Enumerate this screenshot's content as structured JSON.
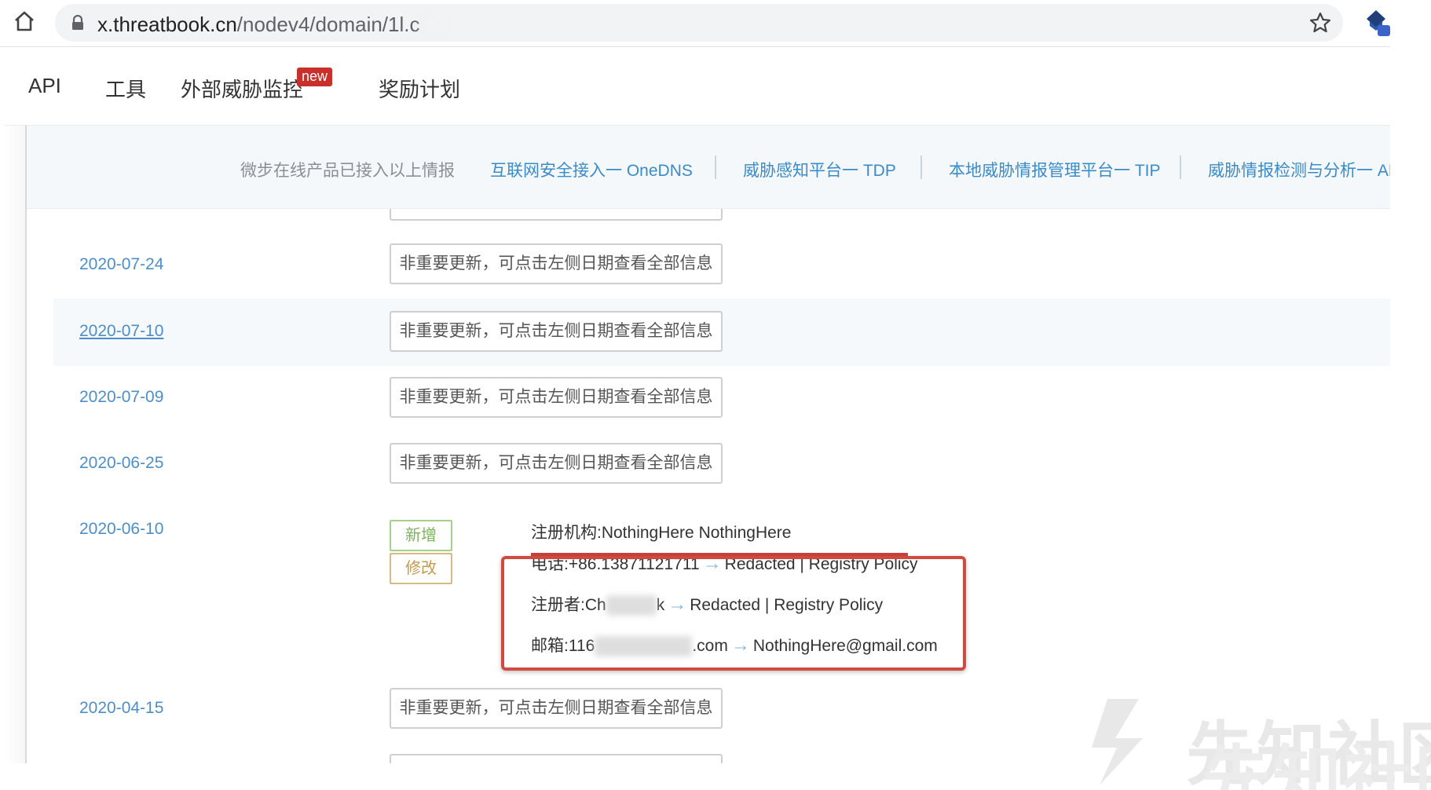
{
  "browser": {
    "url_host": "x.threatbook.cn",
    "url_path": "/nodev4/domain/1l.c",
    "icons": {
      "home": "home-icon",
      "lock": "lock-icon",
      "star": "star-icon",
      "extension": "extension-icon"
    }
  },
  "site_nav": {
    "items": [
      {
        "label": "API"
      },
      {
        "label": "工具"
      },
      {
        "label": "外部威胁监控"
      },
      {
        "label": "奖励计划"
      }
    ],
    "badge": "new"
  },
  "banner": {
    "lead": "微步在线产品已接入以上情报",
    "links": [
      {
        "label": "互联网安全接入一 OneDNS"
      },
      {
        "label": "威胁感知平台一 TDP"
      },
      {
        "label": "本地威胁情报管理平台一 TIP"
      },
      {
        "label": "威胁情报检测与分析一 AP"
      }
    ]
  },
  "history": {
    "summary_text": "非重要更新，可点击左侧日期查看全部信息",
    "rows": [
      {
        "date": "2020-07-24"
      },
      {
        "date": "2020-07-10"
      },
      {
        "date": "2020-07-09"
      },
      {
        "date": "2020-06-25"
      },
      {
        "date": "2020-06-10"
      },
      {
        "date": "2020-04-15"
      }
    ],
    "tags": {
      "added": "新增",
      "modified": "修改"
    },
    "changes": {
      "org": "注册机构:NothingHere NothingHere",
      "phone_label": "电话:+86.13871121711",
      "phone_new": "Redacted | Registry Policy",
      "registrant_label": "注册者:Ch",
      "registrant_tail": "k",
      "registrant_new": "Redacted | Registry Policy",
      "email_label": "邮箱:116",
      "email_tail": ".com",
      "email_new": "NothingHere@gmail.com"
    }
  },
  "watermark": "先知社区"
}
